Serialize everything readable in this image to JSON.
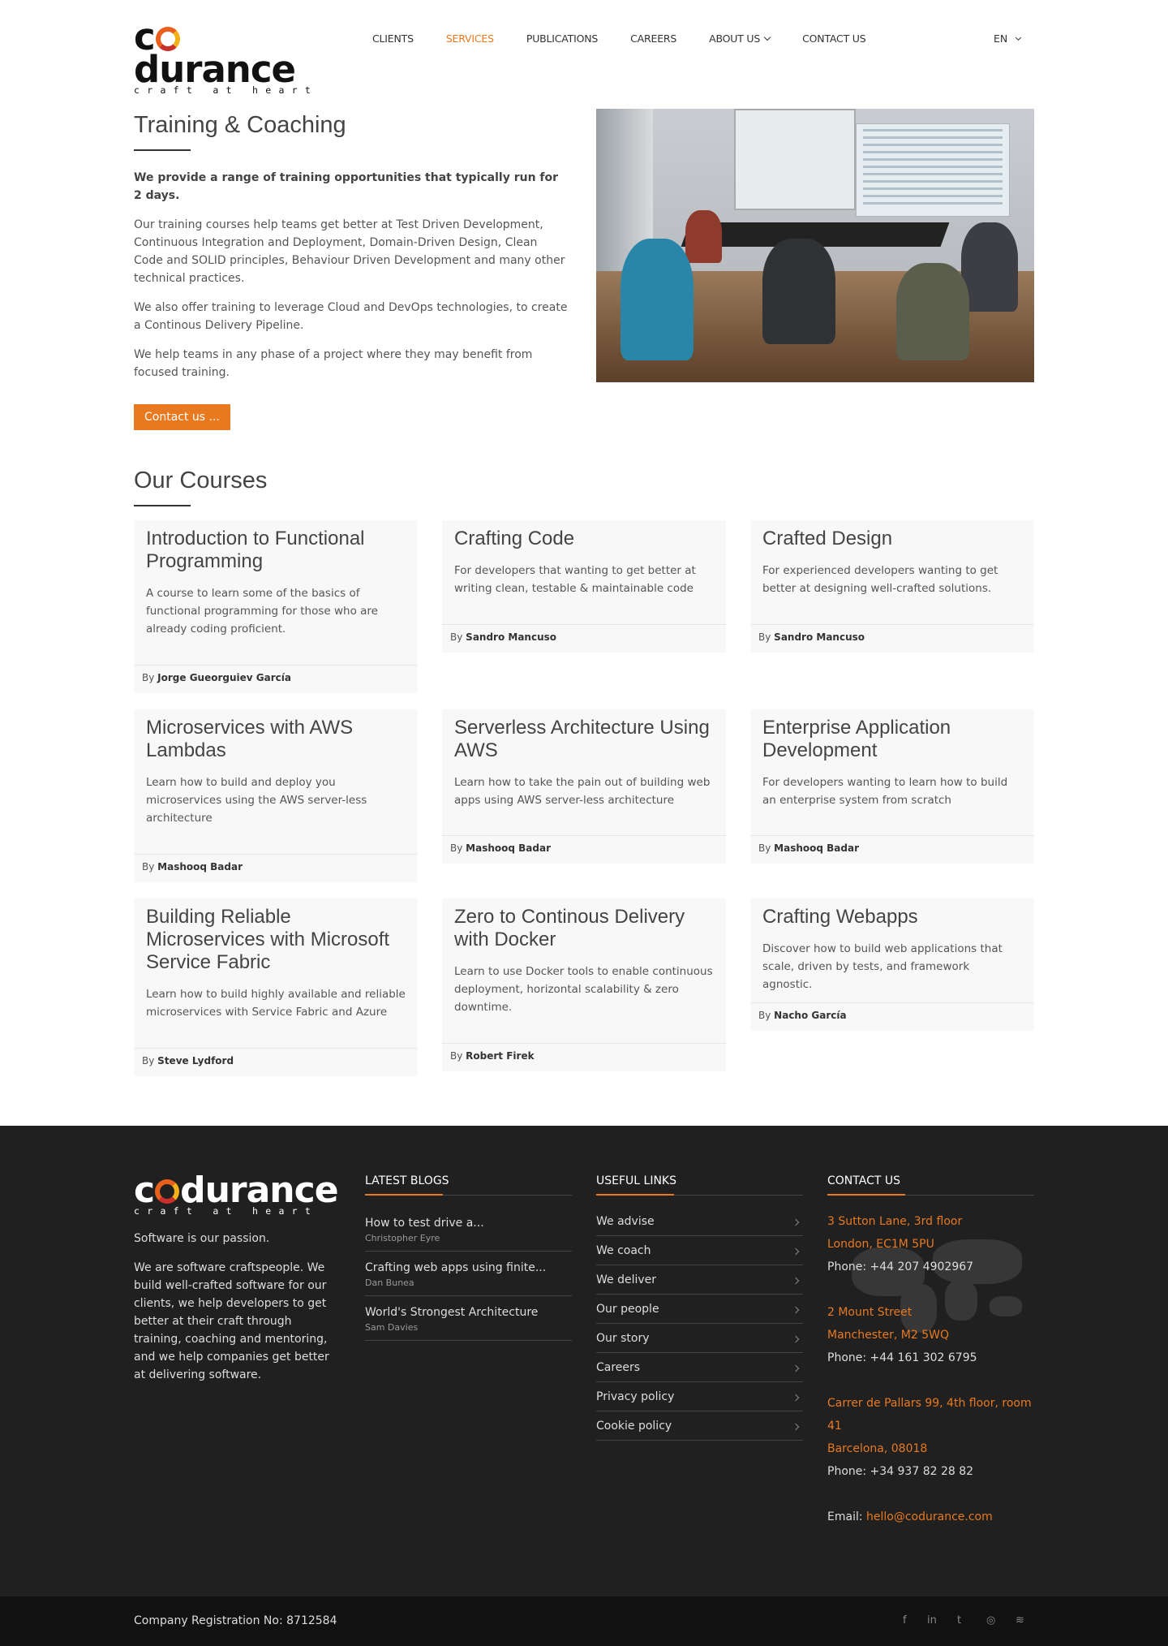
{
  "header": {
    "logo_text": "codurance",
    "logo_tagline": "craft at heart",
    "nav": [
      {
        "label": "CLIENTS"
      },
      {
        "label": "SERVICES",
        "active": true
      },
      {
        "label": "PUBLICATIONS"
      },
      {
        "label": "CAREERS"
      },
      {
        "label": "ABOUT US",
        "dropdown": true
      },
      {
        "label": "CONTACT US"
      }
    ],
    "lang": "EN"
  },
  "intro": {
    "title": "Training & Coaching",
    "lead": "We provide a range of training opportunities that typically run for 2 days.",
    "paragraphs": [
      "Our training courses help teams get better at Test Driven Development, Continuous Integration and Deployment, Domain-Driven Design, Clean Code and SOLID principles, Behaviour Driven Development and many other technical practices.",
      "We also offer training to leverage Cloud and DevOps technologies, to create a Continous Delivery Pipeline.",
      "We help teams in any phase of a project where they may benefit from focused training."
    ],
    "button": "Contact us ..."
  },
  "courses": {
    "title": "Our Courses",
    "by_label": "By",
    "items": [
      {
        "title": "Introduction to Functional Programming",
        "desc": "A course to learn some of the basics of functional programming for those who are already coding proficient.",
        "author": "Jorge Gueorguiev García"
      },
      {
        "title": "Crafting Code",
        "desc": "For developers that wanting to get better at writing clean, testable & maintainable code",
        "author": "Sandro Mancuso"
      },
      {
        "title": "Crafted Design",
        "desc": "For experienced developers wanting to get better at designing well-crafted solutions.",
        "author": "Sandro Mancuso"
      },
      {
        "title": "Microservices with AWS Lambdas",
        "desc": "Learn how to build and deploy you microservices using the AWS server-less architecture",
        "author": "Mashooq Badar"
      },
      {
        "title": "Serverless Architecture Using AWS",
        "desc": "Learn how to take the pain out of building web apps using AWS server-less architecture",
        "author": "Mashooq Badar"
      },
      {
        "title": "Enterprise Application Development",
        "desc": "For developers wanting to learn how to build an enterprise system from scratch",
        "author": "Mashooq Badar"
      },
      {
        "title": "Building Reliable Microservices with Microsoft Service Fabric",
        "desc": "Learn how to build highly available and reliable microservices with Service Fabric and Azure",
        "author": "Steve Lydford"
      },
      {
        "title": "Zero to Continous Delivery with Docker",
        "desc": "Learn to use Docker tools to enable continuous deployment, horizontal scalability & zero downtime.",
        "author": "Robert Firek"
      },
      {
        "title": "Crafting Webapps",
        "desc": "Discover how to build web applications that scale, driven by tests, and framework agnostic.",
        "author": "Nacho García"
      }
    ]
  },
  "footer": {
    "logo_text": "codurance",
    "logo_tagline": "craft at heart",
    "passion": "Software is our passion.",
    "about": "We are software craftspeople. We build well-crafted software for our clients, we help developers to get better at their craft through training, coaching and mentoring, and we help companies get better at delivering software.",
    "blogs_title": "LATEST BLOGS",
    "blogs": [
      {
        "title": "How to test drive a...",
        "author": "Christopher Eyre"
      },
      {
        "title": "Crafting web apps using finite...",
        "author": "Dan Bunea"
      },
      {
        "title": "World's Strongest Architecture",
        "author": "Sam Davies"
      }
    ],
    "links_title": "USEFUL LINKS",
    "links": [
      "We advise",
      "We coach",
      "We deliver",
      "Our people",
      "Our story",
      "Careers",
      "Privacy policy",
      "Cookie policy"
    ],
    "contact_title": "CONTACT US",
    "offices": [
      {
        "line1": "3 Sutton Lane, 3rd floor",
        "line2": "London, EC1M 5PU",
        "phone": "Phone: +44 207 4902967"
      },
      {
        "line1": "2 Mount Street",
        "line2": "Manchester, M2 5WQ",
        "phone": "Phone: +44 161 302 6795"
      },
      {
        "line1": "Carrer de Pallars 99, 4th floor, room 41",
        "line2": "Barcelona, 08018",
        "phone": "Phone: +34 937 82 28 82"
      }
    ],
    "email_label": "Email:",
    "email": "hello@codurance.com"
  },
  "bottom": {
    "registration": "Company Registration No: 8712584",
    "social": [
      {
        "icon": "facebook-icon",
        "glyph": "f"
      },
      {
        "icon": "linkedin-icon",
        "glyph": "in"
      },
      {
        "icon": "twitter-icon",
        "glyph": "t"
      },
      {
        "icon": "instagram-icon",
        "glyph": "◎"
      },
      {
        "icon": "rss-icon",
        "glyph": "≋"
      }
    ]
  },
  "colors": {
    "accent": "#e8791f",
    "footer_bg": "#202020",
    "bottom_bg": "#111111"
  }
}
